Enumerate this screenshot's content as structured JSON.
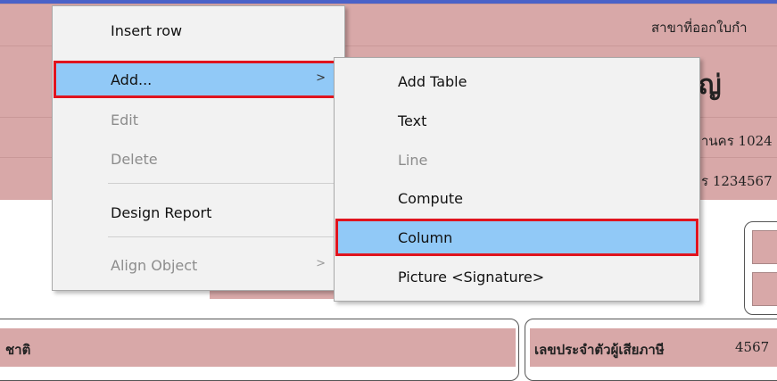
{
  "report": {
    "row1_right": "สาขาที่ออกใบกำ",
    "row2_right": "ญ่",
    "row3_right": "านคร 1024",
    "row4_right": "ร 1234567",
    "bottom_left": "ชาติ",
    "bottom_mid": "เลขประจำตัวผู้เสียภาษี",
    "bottom_right": "4567"
  },
  "context_menu": {
    "items": [
      {
        "label": "Insert row",
        "enabled": true
      },
      {
        "label": "Add...",
        "enabled": true,
        "has_submenu": true,
        "highlighted": true
      },
      {
        "label": "Edit",
        "enabled": false
      },
      {
        "label": "Delete",
        "enabled": false
      },
      {
        "label": "Design Report",
        "enabled": true
      },
      {
        "label": "Align Object",
        "enabled": false,
        "has_submenu": true
      }
    ],
    "arrow_glyph": ">"
  },
  "submenu": {
    "items": [
      {
        "label": "Add Table",
        "enabled": true
      },
      {
        "label": "Text",
        "enabled": true
      },
      {
        "label": "Line",
        "enabled": false
      },
      {
        "label": "Compute",
        "enabled": true
      },
      {
        "label": "Column",
        "enabled": true,
        "highlighted": true
      },
      {
        "label": "Picture <Signature>",
        "enabled": true
      }
    ]
  },
  "colors": {
    "band": "#d8a8a8",
    "highlight": "#91c9f7",
    "focus_outline": "#e0141e",
    "accent_line": "#4a62c8"
  }
}
